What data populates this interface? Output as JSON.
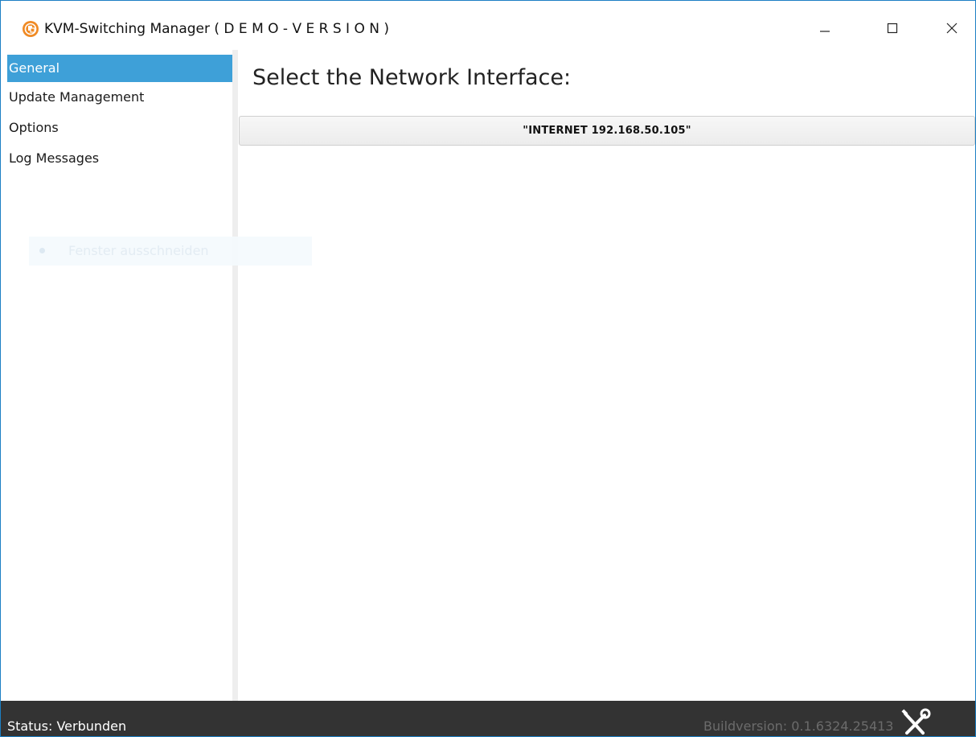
{
  "window": {
    "title": "KVM-Switching Manager ( D E M O - V E R S I O N )",
    "icon": "app-logo-icon",
    "controls": {
      "minimize": "minimize-icon",
      "maximize": "maximize-icon",
      "close": "close-icon"
    }
  },
  "sidebar": {
    "items": [
      {
        "label": "General",
        "active": true
      },
      {
        "label": "Update Management",
        "active": false
      },
      {
        "label": "Options",
        "active": false
      },
      {
        "label": "Log Messages",
        "active": false
      }
    ],
    "ghost_overlay": {
      "label": "Fenster ausschneiden"
    }
  },
  "main": {
    "title": "Select the Network Interface:",
    "interfaces": [
      {
        "label": "\"INTERNET 192.168.50.105\""
      }
    ]
  },
  "status": {
    "text": "Status: Verbunden",
    "build": "Buildversion: 0.1.6324.25413",
    "tools_icon": "tools-icon"
  },
  "colors": {
    "accent": "#3ea0d8",
    "window_border": "#1c7fc4",
    "statusbar": "#333333",
    "logo": "#f08a24"
  }
}
